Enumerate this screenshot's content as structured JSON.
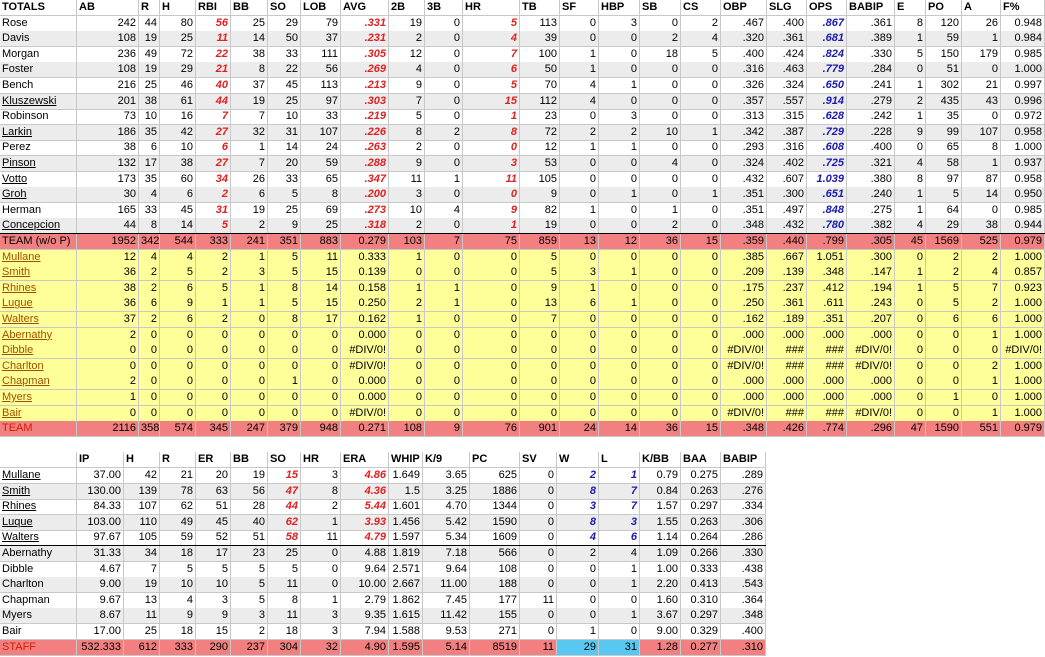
{
  "batting": {
    "headers": [
      "TOTALS",
      "AB",
      "R",
      "H",
      "RBI",
      "BB",
      "SO",
      "LOB",
      "AVG",
      "2B",
      "3B",
      "HR",
      "TB",
      "SF",
      "HBP",
      "SB",
      "CS",
      "OBP",
      "SLG",
      "OPS",
      "BABIP",
      "E",
      "PO",
      "A",
      "F%"
    ],
    "rows": [
      [
        "Rose",
        "242",
        "44",
        "80",
        "56",
        "25",
        "29",
        "79",
        ".331",
        "19",
        "0",
        "5",
        "113",
        "0",
        "3",
        "0",
        "2",
        ".467",
        ".400",
        ".867",
        ".361",
        "8",
        "120",
        "26",
        "0.948"
      ],
      [
        "Davis",
        "108",
        "19",
        "25",
        "11",
        "14",
        "50",
        "37",
        ".231",
        "2",
        "0",
        "4",
        "39",
        "0",
        "0",
        "2",
        "4",
        ".320",
        ".361",
        ".681",
        ".389",
        "1",
        "59",
        "1",
        "0.984"
      ],
      [
        "Morgan",
        "236",
        "49",
        "72",
        "22",
        "38",
        "33",
        "111",
        ".305",
        "12",
        "0",
        "7",
        "100",
        "1",
        "0",
        "18",
        "5",
        ".400",
        ".424",
        ".824",
        ".330",
        "5",
        "150",
        "179",
        "0.985"
      ],
      [
        "Foster",
        "108",
        "19",
        "29",
        "21",
        "8",
        "22",
        "56",
        ".269",
        "4",
        "0",
        "6",
        "50",
        "1",
        "0",
        "0",
        "0",
        ".316",
        ".463",
        ".779",
        ".284",
        "0",
        "51",
        "0",
        "1.000"
      ],
      [
        "Bench",
        "216",
        "25",
        "46",
        "40",
        "37",
        "45",
        "113",
        ".213",
        "9",
        "0",
        "5",
        "70",
        "4",
        "1",
        "0",
        "0",
        ".326",
        ".324",
        ".650",
        ".241",
        "1",
        "302",
        "21",
        "0.997"
      ],
      [
        "Kluszewski",
        "201",
        "38",
        "61",
        "44",
        "19",
        "25",
        "97",
        ".303",
        "7",
        "0",
        "15",
        "112",
        "4",
        "0",
        "0",
        "0",
        ".357",
        ".557",
        ".914",
        ".279",
        "2",
        "435",
        "43",
        "0.996"
      ],
      [
        "Robinson",
        "73",
        "10",
        "16",
        "7",
        "7",
        "10",
        "33",
        ".219",
        "5",
        "0",
        "1",
        "23",
        "0",
        "3",
        "0",
        "0",
        ".313",
        ".315",
        ".628",
        ".242",
        "1",
        "35",
        "0",
        "0.972"
      ],
      [
        "Larkin",
        "186",
        "35",
        "42",
        "27",
        "32",
        "31",
        "107",
        ".226",
        "8",
        "2",
        "8",
        "72",
        "2",
        "2",
        "10",
        "1",
        ".342",
        ".387",
        ".729",
        ".228",
        "9",
        "99",
        "107",
        "0.958"
      ],
      [
        "Perez",
        "38",
        "6",
        "10",
        "6",
        "1",
        "14",
        "24",
        ".263",
        "2",
        "0",
        "0",
        "12",
        "1",
        "1",
        "0",
        "0",
        ".293",
        ".316",
        ".608",
        ".400",
        "0",
        "65",
        "8",
        "1.000"
      ],
      [
        "Pinson",
        "132",
        "17",
        "38",
        "27",
        "7",
        "20",
        "59",
        ".288",
        "9",
        "0",
        "3",
        "53",
        "0",
        "0",
        "4",
        "0",
        ".324",
        ".402",
        ".725",
        ".321",
        "4",
        "58",
        "1",
        "0.937"
      ],
      [
        "Votto",
        "173",
        "35",
        "60",
        "34",
        "26",
        "33",
        "65",
        ".347",
        "11",
        "1",
        "11",
        "105",
        "0",
        "0",
        "0",
        "0",
        ".432",
        ".607",
        "1.039",
        ".380",
        "8",
        "97",
        "87",
        "0.958"
      ],
      [
        "Groh",
        "30",
        "4",
        "6",
        "2",
        "6",
        "5",
        "8",
        ".200",
        "3",
        "0",
        "0",
        "9",
        "0",
        "1",
        "0",
        "1",
        ".351",
        ".300",
        ".651",
        ".240",
        "1",
        "5",
        "14",
        "0.950"
      ],
      [
        "Herman",
        "165",
        "33",
        "45",
        "31",
        "19",
        "25",
        "69",
        ".273",
        "10",
        "4",
        "9",
        "82",
        "1",
        "0",
        "1",
        "0",
        ".351",
        ".497",
        ".848",
        ".275",
        "1",
        "64",
        "0",
        "0.985"
      ],
      [
        "Concepcion",
        "44",
        "8",
        "14",
        "5",
        "2",
        "9",
        "25",
        ".318",
        "2",
        "0",
        "1",
        "19",
        "0",
        "0",
        "2",
        "0",
        ".348",
        ".432",
        ".780",
        ".382",
        "4",
        "29",
        "38",
        "0.944"
      ]
    ],
    "team_wo": [
      "TEAM (w/o P)",
      "1952",
      "342",
      "544",
      "333",
      "241",
      "351",
      "883",
      "0.279",
      "103",
      "7",
      "75",
      "859",
      "13",
      "12",
      "36",
      "15",
      ".359",
      ".440",
      ".799",
      ".305",
      "45",
      "1569",
      "525",
      "0.979"
    ],
    "pitchers": [
      [
        "Mullane",
        "12",
        "4",
        "4",
        "2",
        "1",
        "5",
        "11",
        "0.333",
        "1",
        "0",
        "0",
        "5",
        "0",
        "0",
        "0",
        "0",
        ".385",
        ".667",
        "1.051",
        ".300",
        "0",
        "2",
        "2",
        "1.000"
      ],
      [
        "Smith",
        "36",
        "2",
        "5",
        "2",
        "3",
        "5",
        "15",
        "0.139",
        "0",
        "0",
        "0",
        "5",
        "3",
        "1",
        "0",
        "0",
        ".209",
        ".139",
        ".348",
        ".147",
        "1",
        "2",
        "4",
        "0.857"
      ],
      [
        "Rhines",
        "38",
        "2",
        "6",
        "5",
        "1",
        "8",
        "14",
        "0.158",
        "1",
        "1",
        "0",
        "9",
        "1",
        "0",
        "0",
        "0",
        ".175",
        ".237",
        ".412",
        ".194",
        "1",
        "5",
        "7",
        "0.923"
      ],
      [
        "Lugue",
        "36",
        "6",
        "9",
        "1",
        "1",
        "5",
        "15",
        "0.250",
        "2",
        "1",
        "0",
        "13",
        "6",
        "1",
        "0",
        "0",
        ".250",
        ".361",
        ".611",
        ".243",
        "0",
        "5",
        "2",
        "1.000"
      ],
      [
        "Walters",
        "37",
        "2",
        "6",
        "2",
        "0",
        "8",
        "17",
        "0.162",
        "1",
        "0",
        "0",
        "7",
        "0",
        "0",
        "0",
        "0",
        ".162",
        ".189",
        ".351",
        ".207",
        "0",
        "6",
        "6",
        "1.000"
      ],
      [
        "Abernathy",
        "2",
        "0",
        "0",
        "0",
        "0",
        "0",
        "0",
        "0.000",
        "0",
        "0",
        "0",
        "0",
        "0",
        "0",
        "0",
        "0",
        ".000",
        ".000",
        ".000",
        ".000",
        "0",
        "0",
        "1",
        "1.000"
      ],
      [
        "Dibble",
        "0",
        "0",
        "0",
        "0",
        "0",
        "0",
        "0",
        "#DIV/0!",
        "0",
        "0",
        "0",
        "0",
        "0",
        "0",
        "0",
        "0",
        "#DIV/0!",
        "###",
        "###",
        "#DIV/0!",
        "0",
        "0",
        "0",
        "#DIV/0!"
      ],
      [
        "Charlton",
        "0",
        "0",
        "0",
        "0",
        "0",
        "0",
        "0",
        "#DIV/0!",
        "0",
        "0",
        "0",
        "0",
        "0",
        "0",
        "0",
        "0",
        "#DIV/0!",
        "###",
        "###",
        "#DIV/0!",
        "0",
        "0",
        "2",
        "1.000"
      ],
      [
        "Chapman",
        "2",
        "0",
        "0",
        "0",
        "0",
        "1",
        "0",
        "0.000",
        "0",
        "0",
        "0",
        "0",
        "0",
        "0",
        "0",
        "0",
        ".000",
        ".000",
        ".000",
        ".000",
        "0",
        "0",
        "1",
        "1.000"
      ],
      [
        "Myers",
        "1",
        "0",
        "0",
        "0",
        "0",
        "0",
        "0",
        "0.000",
        "0",
        "0",
        "0",
        "0",
        "0",
        "0",
        "0",
        "0",
        ".000",
        ".000",
        ".000",
        ".000",
        "0",
        "1",
        "0",
        "1.000"
      ],
      [
        "Bair",
        "0",
        "0",
        "0",
        "0",
        "0",
        "0",
        "0",
        "#DIV/0!",
        "0",
        "0",
        "0",
        "0",
        "0",
        "0",
        "0",
        "0",
        "#DIV/0!",
        "###",
        "###",
        "#DIV/0!",
        "0",
        "0",
        "1",
        "1.000"
      ]
    ],
    "team": [
      "TEAM",
      "2116",
      "358",
      "574",
      "345",
      "247",
      "379",
      "948",
      "0.271",
      "108",
      "9",
      "76",
      "901",
      "24",
      "14",
      "36",
      "15",
      ".348",
      ".426",
      ".774",
      ".296",
      "47",
      "1590",
      "551",
      "0.979"
    ]
  },
  "pitching": {
    "headers": [
      "",
      "IP",
      "H",
      "R",
      "ER",
      "BB",
      "SO",
      "HR",
      "ERA",
      "WHIP",
      "K/9",
      "PC",
      "SV",
      "W",
      "L",
      "K/BB",
      "BAA",
      "BABIP"
    ],
    "rows": [
      [
        "Mullane",
        "37.00",
        "42",
        "21",
        "20",
        "19",
        "15",
        "3",
        "4.86",
        "1.649",
        "3.65",
        "625",
        "0",
        "2",
        "1",
        "0.79",
        "0.275",
        ".289"
      ],
      [
        "Smith",
        "130.00",
        "139",
        "78",
        "63",
        "56",
        "47",
        "8",
        "4.36",
        "1.5",
        "3.25",
        "1886",
        "0",
        "8",
        "7",
        "0.84",
        "0.263",
        ".276"
      ],
      [
        "Rhines",
        "84.33",
        "107",
        "62",
        "51",
        "28",
        "44",
        "2",
        "5.44",
        "1.601",
        "4.70",
        "1344",
        "0",
        "3",
        "7",
        "1.57",
        "0.297",
        ".334"
      ],
      [
        "Luque",
        "103.00",
        "110",
        "49",
        "45",
        "40",
        "62",
        "1",
        "3.93",
        "1.456",
        "5.42",
        "1590",
        "0",
        "8",
        "3",
        "1.55",
        "0.263",
        ".306"
      ],
      [
        "Walters",
        "97.67",
        "105",
        "59",
        "52",
        "51",
        "58",
        "11",
        "4.79",
        "1.597",
        "5.34",
        "1609",
        "0",
        "4",
        "6",
        "1.14",
        "0.264",
        ".286"
      ],
      [
        "Abernathy",
        "31.33",
        "34",
        "18",
        "17",
        "23",
        "25",
        "0",
        "4.88",
        "1.819",
        "7.18",
        "566",
        "0",
        "2",
        "4",
        "1.09",
        "0.266",
        ".330"
      ],
      [
        "Dibble",
        "4.67",
        "7",
        "5",
        "5",
        "5",
        "5",
        "0",
        "9.64",
        "2.571",
        "9.64",
        "108",
        "0",
        "0",
        "1",
        "1.00",
        "0.333",
        ".438"
      ],
      [
        "Charlton",
        "9.00",
        "19",
        "10",
        "10",
        "5",
        "11",
        "0",
        "10.00",
        "2.667",
        "11.00",
        "188",
        "0",
        "0",
        "1",
        "2.20",
        "0.413",
        ".543"
      ],
      [
        "Chapman",
        "9.67",
        "13",
        "4",
        "3",
        "5",
        "8",
        "1",
        "2.79",
        "1.862",
        "7.45",
        "177",
        "11",
        "0",
        "0",
        "1.60",
        "0.310",
        ".364"
      ],
      [
        "Myers",
        "8.67",
        "11",
        "9",
        "9",
        "3",
        "11",
        "3",
        "9.35",
        "1.615",
        "11.42",
        "155",
        "0",
        "0",
        "1",
        "3.67",
        "0.297",
        ".348"
      ],
      [
        "Bair",
        "17.00",
        "25",
        "18",
        "15",
        "2",
        "18",
        "3",
        "7.94",
        "1.588",
        "9.53",
        "271",
        "0",
        "1",
        "0",
        "9.00",
        "0.329",
        ".400"
      ]
    ],
    "staff": [
      "STAFF",
      "532.333",
      "612",
      "333",
      "290",
      "237",
      "304",
      "32",
      "4.90",
      "1.595",
      "5.14",
      "8519",
      "11",
      "29",
      "31",
      "1.28",
      "0.277",
      ".310"
    ]
  }
}
